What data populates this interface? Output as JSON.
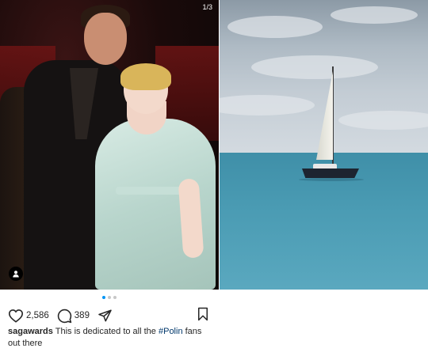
{
  "post": {
    "image_counter": "1/3",
    "likes": "2,586",
    "comments": "389",
    "caption_user": "sagawards",
    "caption_before": " This is dedicated to all the ",
    "caption_hashtag": "#Polin",
    "caption_after": " fans out there",
    "carousel_total": 3,
    "carousel_active": 1
  },
  "icons": {
    "like": "heart-icon",
    "comment": "comment-icon",
    "share": "send-icon",
    "save": "bookmark-icon",
    "user_tag": "person-icon"
  },
  "colors": {
    "active_dot": "#0095f6",
    "hashtag": "#00376b",
    "text": "#262626"
  }
}
